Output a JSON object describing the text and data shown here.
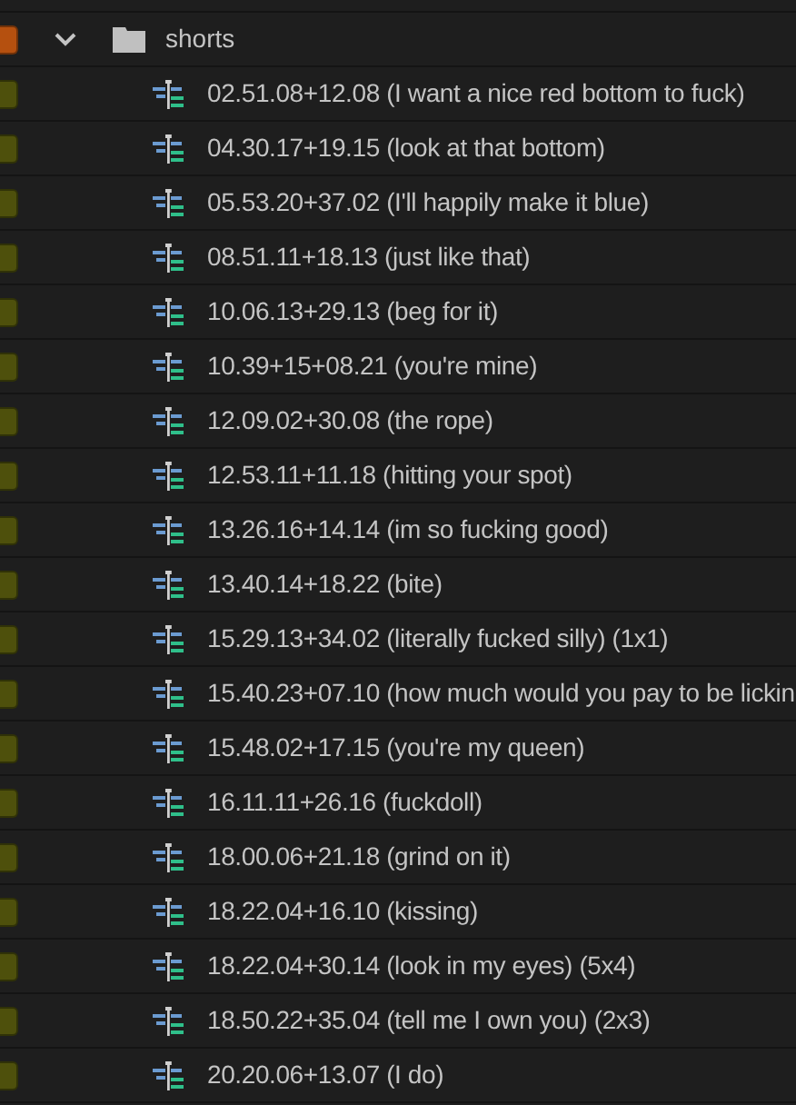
{
  "folder": {
    "name": "shorts",
    "expanded": true,
    "color": "#b5500f"
  },
  "items": [
    {
      "name": "02.51.08+12.08 (I want a nice red bottom to fuck)",
      "color": "#4e500c"
    },
    {
      "name": "04.30.17+19.15 (look at that bottom)",
      "color": "#4e500c"
    },
    {
      "name": "05.53.20+37.02 (I'll happily make it blue)",
      "color": "#4e500c"
    },
    {
      "name": "08.51.11+18.13 (just like that)",
      "color": "#4e500c"
    },
    {
      "name": "10.06.13+29.13 (beg for it)",
      "color": "#4e500c"
    },
    {
      "name": "10.39+15+08.21 (you're mine)",
      "color": "#4e500c"
    },
    {
      "name": "12.09.02+30.08 (the rope)",
      "color": "#4e500c"
    },
    {
      "name": "12.53.11+11.18 (hitting your spot)",
      "color": "#4e500c"
    },
    {
      "name": "13.26.16+14.14 (im so fucking good)",
      "color": "#4e500c"
    },
    {
      "name": "13.40.14+18.22 (bite)",
      "color": "#4e500c"
    },
    {
      "name": "15.29.13+34.02 (literally fucked silly) (1x1)",
      "color": "#4e500c"
    },
    {
      "name": "15.40.23+07.10 (how much would you pay to be lickin",
      "color": "#4e500c"
    },
    {
      "name": "15.48.02+17.15 (you're my queen)",
      "color": "#4e500c"
    },
    {
      "name": "16.11.11+26.16 (fuckdoll)",
      "color": "#4e500c"
    },
    {
      "name": "18.00.06+21.18 (grind on it)",
      "color": "#4e500c"
    },
    {
      "name": "18.22.04+16.10 (kissing)",
      "color": "#4e500c"
    },
    {
      "name": "18.22.04+30.14 (look in my eyes) (5x4)",
      "color": "#4e500c"
    },
    {
      "name": "18.50.22+35.04 (tell me I own you) (2x3)",
      "color": "#4e500c"
    },
    {
      "name": "20.20.06+13.07 (I do)",
      "color": "#4e500c"
    }
  ]
}
